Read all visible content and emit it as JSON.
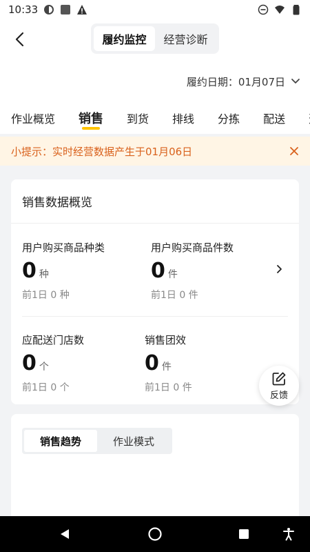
{
  "status_bar": {
    "time": "10:33"
  },
  "header": {
    "back_icon": "chevron-left-icon",
    "segments": [
      {
        "label": "履约监控",
        "active": true
      },
      {
        "label": "经营诊断",
        "active": false
      }
    ]
  },
  "date_filter": {
    "label": "履约日期：01月07日"
  },
  "tabs": [
    {
      "label": "作业概览",
      "active": false
    },
    {
      "label": "销售",
      "active": true
    },
    {
      "label": "到货",
      "active": false
    },
    {
      "label": "排线",
      "active": false
    },
    {
      "label": "分拣",
      "active": false
    },
    {
      "label": "配送",
      "active": false
    },
    {
      "label": "逆向",
      "active": false
    }
  ],
  "tip": {
    "text": "小提示：实时经营数据产生于01月06日"
  },
  "overview": {
    "title": "销售数据概览",
    "metrics": [
      {
        "label": "用户购买商品种类",
        "value": "0",
        "unit": "种",
        "prev": "前1日 0 种"
      },
      {
        "label": "用户购买商品件数",
        "value": "0",
        "unit": "件",
        "prev": "前1日 0 件"
      },
      {
        "label": "应配送门店数",
        "value": "0",
        "unit": "个",
        "prev": "前1日 0 个"
      },
      {
        "label": "销售团效",
        "value": "0",
        "unit": "件",
        "prev": "前1日 0 件"
      }
    ]
  },
  "feedback": {
    "label": "反馈"
  },
  "trend": {
    "segments": [
      {
        "label": "销售趋势",
        "active": true
      },
      {
        "label": "作业模式",
        "active": false
      }
    ]
  },
  "colors": {
    "accent": "#ffc400",
    "tip_bg": "#fff5e5",
    "tip_text": "#d9611c"
  }
}
